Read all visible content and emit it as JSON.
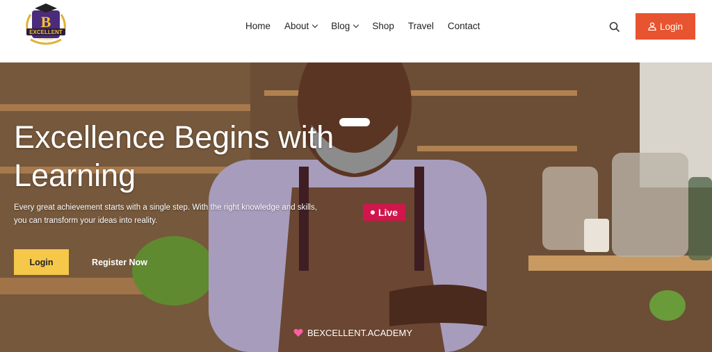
{
  "logo": {
    "letter": "B",
    "name": "EXCELLENT",
    "sub": "ACADEMY"
  },
  "nav": {
    "items": [
      {
        "label": "Home"
      },
      {
        "label": "About"
      },
      {
        "label": "Blog"
      },
      {
        "label": "Shop"
      },
      {
        "label": "Travel"
      },
      {
        "label": "Contact"
      }
    ]
  },
  "header": {
    "login_label": "Login"
  },
  "hero": {
    "title": "Excellence Begins with Learning",
    "description": "Every great achievement starts with a single step. With the right knowledge and skills, you can transform your ideas into reality.",
    "login_label": "Login",
    "register_label": "Register Now",
    "live_label": "Live",
    "brand": "BEXCELLENT.ACADEMY"
  },
  "colors": {
    "accent": "#e8542f",
    "yellow": "#f5c84a",
    "live": "#d0164a",
    "heart": "#ff5fa2"
  }
}
